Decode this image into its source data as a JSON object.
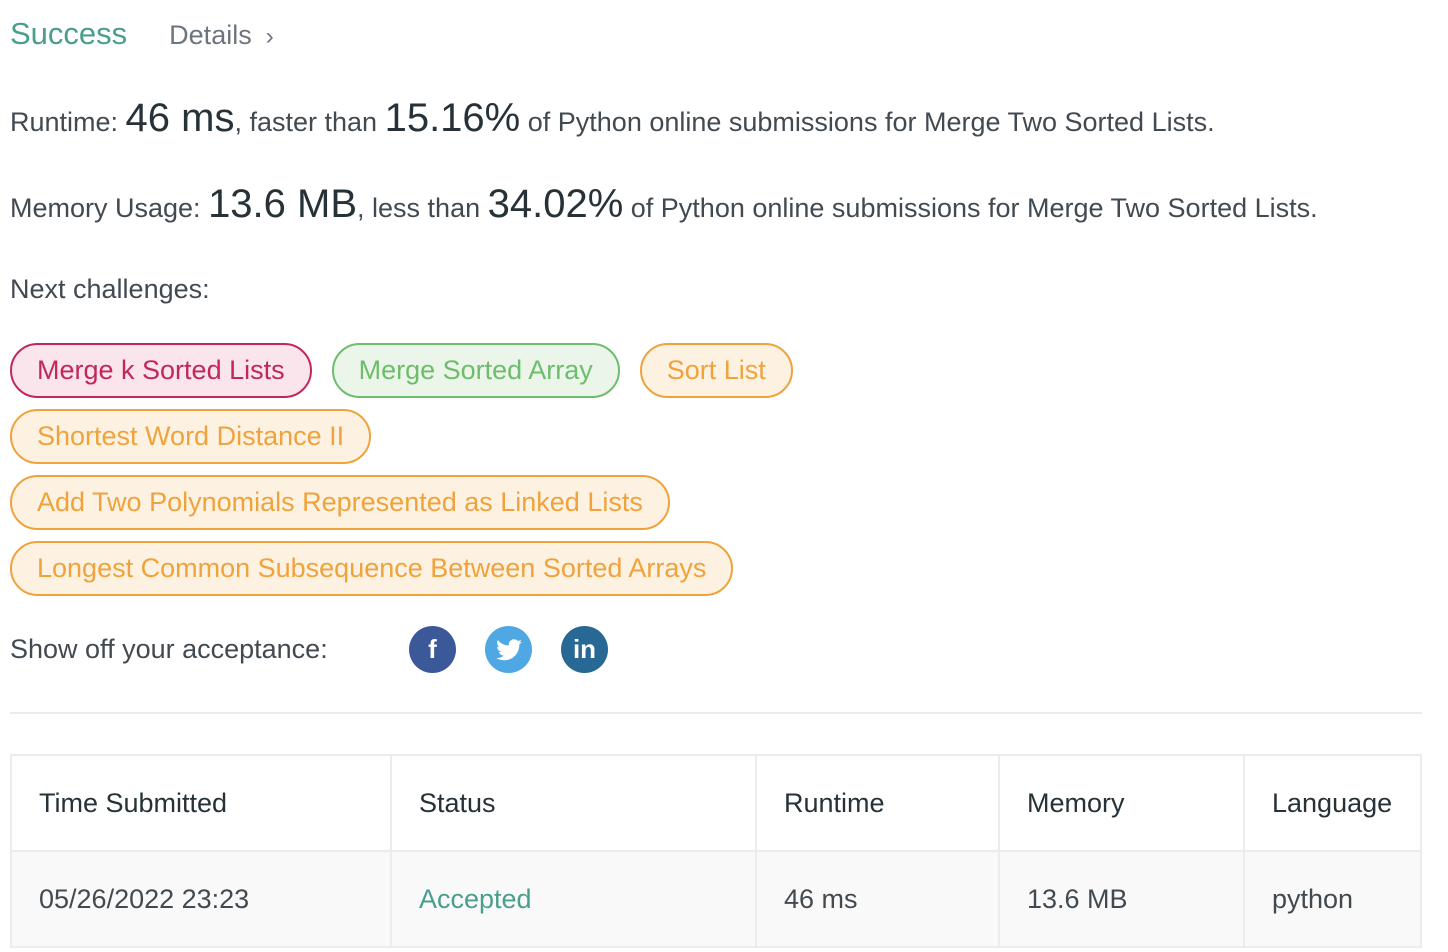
{
  "header": {
    "status": "Success",
    "details_label": "Details",
    "chevron": "chevron-right-icon"
  },
  "runtime": {
    "label": "Runtime: ",
    "value": "46 ms",
    "mid": ", faster than ",
    "percent": "15.16%",
    "suffix": " of Python online submissions for Merge Two Sorted Lists."
  },
  "memory": {
    "label": "Memory Usage: ",
    "value": "13.6 MB",
    "mid": ", less than ",
    "percent": "34.02%",
    "suffix": " of Python online submissions for Merge Two Sorted Lists."
  },
  "next_label": "Next challenges:",
  "challenges": [
    {
      "label": "Merge k Sorted Lists",
      "difficulty": "hard",
      "color": "#c2275c"
    },
    {
      "label": "Merge Sorted Array",
      "difficulty": "easy",
      "color": "#6ebd6c"
    },
    {
      "label": "Sort List",
      "difficulty": "medium",
      "color": "#f0a23b"
    },
    {
      "label": "Shortest Word Distance II",
      "difficulty": "medium",
      "color": "#f0a23b"
    },
    {
      "label": "Add Two Polynomials Represented as Linked Lists",
      "difficulty": "medium",
      "color": "#f0a23b"
    },
    {
      "label": "Longest Common Subsequence Between Sorted Arrays",
      "difficulty": "medium",
      "color": "#f0a23b"
    }
  ],
  "share": {
    "label": "Show off your acceptance:",
    "icons": [
      "facebook-icon",
      "twitter-icon",
      "linkedin-icon"
    ],
    "facebook": "f",
    "linkedin": "in"
  },
  "table": {
    "headers": [
      "Time Submitted",
      "Status",
      "Runtime",
      "Memory",
      "Language"
    ],
    "rows": [
      [
        "05/26/2022 23:23",
        "Accepted",
        "46 ms",
        "13.6 MB",
        "python"
      ]
    ]
  }
}
